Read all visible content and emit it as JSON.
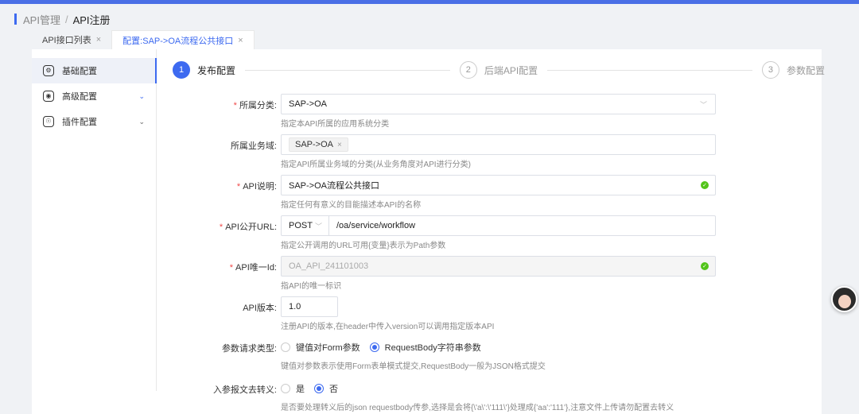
{
  "breadcrumb": {
    "parent": "API管理",
    "separator": "/",
    "current": "API注册"
  },
  "tabs": [
    {
      "label": "API接口列表",
      "close": "×"
    },
    {
      "label": "配置:SAP->OA流程公共接口",
      "close": "×"
    }
  ],
  "sidenav": [
    {
      "label": "基础配置",
      "icon": "settings-icon",
      "glyph": "⚙"
    },
    {
      "label": "高级配置",
      "icon": "advanced-icon",
      "glyph": "◉",
      "chevron": "⌄"
    },
    {
      "label": "插件配置",
      "icon": "plugin-icon",
      "glyph": "☉",
      "chevron": "⌄"
    }
  ],
  "steps": [
    {
      "num": "1",
      "label": "发布配置"
    },
    {
      "num": "2",
      "label": "后端API配置"
    },
    {
      "num": "3",
      "label": "参数配置"
    }
  ],
  "form": {
    "category": {
      "required": "*",
      "label": "所属分类:",
      "value": "SAP->OA",
      "help": "指定本API所属的应用系统分类"
    },
    "domain": {
      "label": "所属业务域:",
      "tag": "SAP->OA",
      "tag_close": "×",
      "help": "指定API所属业务域的分类(从业务角度对API进行分类)"
    },
    "description": {
      "required": "*",
      "label": "API说明:",
      "value": "SAP->OA流程公共接口",
      "help": "指定任何有意义的目能描述本API的名称"
    },
    "public_url": {
      "required": "*",
      "label": "API公开URL:",
      "method": "POST",
      "value": "/oa/service/workflow",
      "help": "指定公开调用的URL可用{变量}表示为Path参数"
    },
    "unique_id": {
      "required": "*",
      "label": "API唯一Id:",
      "value": "OA_API_241101003",
      "help": "指API的唯一标识"
    },
    "version": {
      "label": "API版本:",
      "value": "1.0",
      "help": "注册API的版本,在header中传入version可以调用指定版本API"
    },
    "request_type": {
      "label": "参数请求类型:",
      "options": [
        "键值对Form参数",
        "RequestBody字符串参数"
      ],
      "selected": 1,
      "help": "键值对参数表示使用Form表单模式提交,RequestBody一般为JSON格式提交"
    },
    "unescape": {
      "label": "入参报文去转义:",
      "options": [
        "是",
        "否"
      ],
      "selected": 1,
      "help": "是否要处理转义后的json requestbody传参,选择是会将{\\'a\\':\\'111\\'}处理成{'aa':'111'},注意文件上传请勿配置去转义"
    }
  },
  "colors": {
    "primary": "#3d6af0",
    "required": "#f04848",
    "success": "#52c41a"
  }
}
